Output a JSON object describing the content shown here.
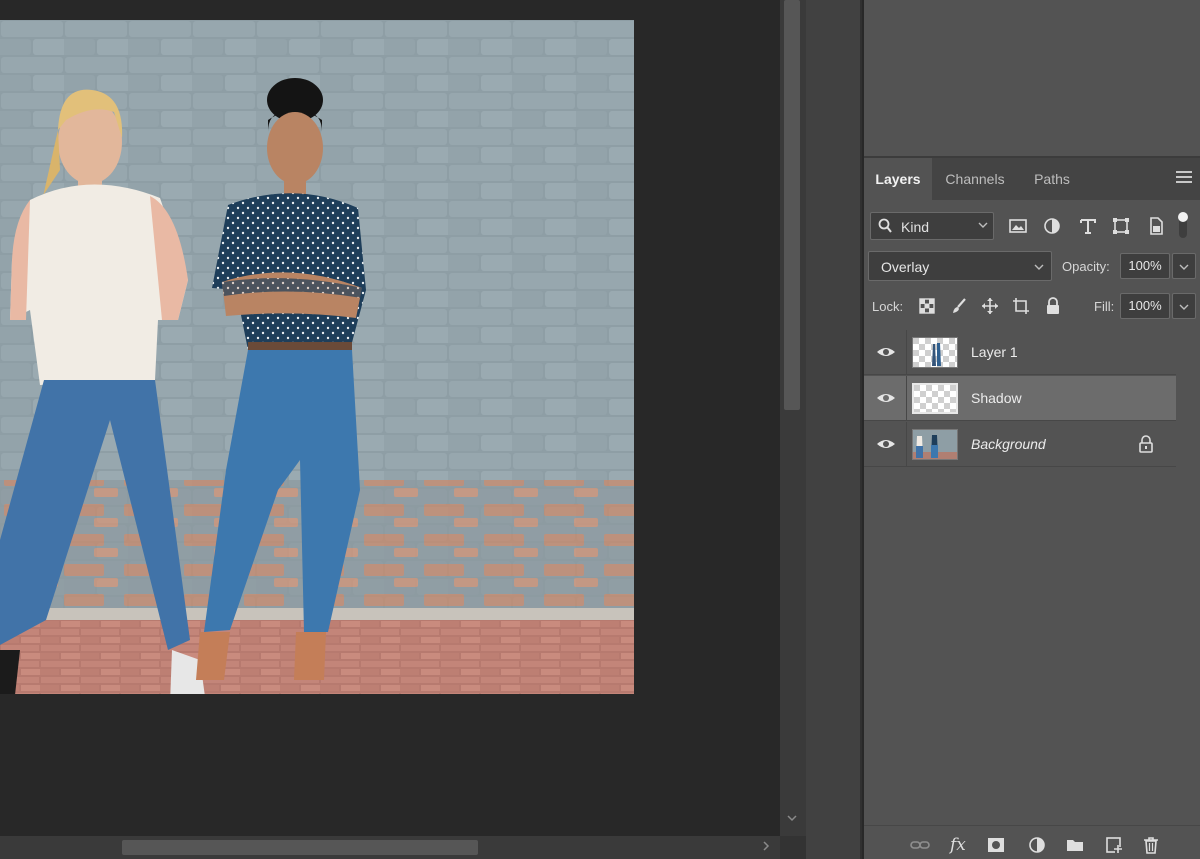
{
  "canvas": {
    "image_alt": "Photo of two women standing against a painted grey brick wall"
  },
  "panel": {
    "tabs": [
      {
        "label": "Layers",
        "active": true
      },
      {
        "label": "Channels",
        "active": false
      },
      {
        "label": "Paths",
        "active": false
      }
    ],
    "filter": {
      "kind_label": "Kind",
      "icons": [
        "image-filter-icon",
        "adjustment-filter-icon",
        "type-filter-icon",
        "shape-filter-icon",
        "smart-object-filter-icon"
      ]
    },
    "blend": {
      "mode": "Overlay",
      "opacity_label": "Opacity:",
      "opacity_value": "100%"
    },
    "lock": {
      "label": "Lock:",
      "icons": [
        "lock-transparent-pixels-icon",
        "lock-image-pixels-icon",
        "lock-position-icon",
        "lock-artboard-icon",
        "lock-all-icon"
      ],
      "fill_label": "Fill:",
      "fill_value": "100%"
    },
    "layers": [
      {
        "name": "Layer 1",
        "visible": true,
        "selected": false,
        "locked": false
      },
      {
        "name": "Shadow",
        "visible": true,
        "selected": true,
        "locked": false
      },
      {
        "name": "Background",
        "visible": true,
        "selected": false,
        "locked": true
      }
    ],
    "bottom_icons": [
      "link-layers-icon",
      "layer-style-fx-icon",
      "add-mask-icon",
      "adjustment-layer-icon",
      "new-group-icon",
      "new-layer-icon",
      "delete-layer-icon"
    ],
    "fx_label": "fx"
  },
  "colors": {
    "canvas_bg": "#282828",
    "panel_bg": "#535353",
    "selected_row": "#6c6c6c"
  }
}
